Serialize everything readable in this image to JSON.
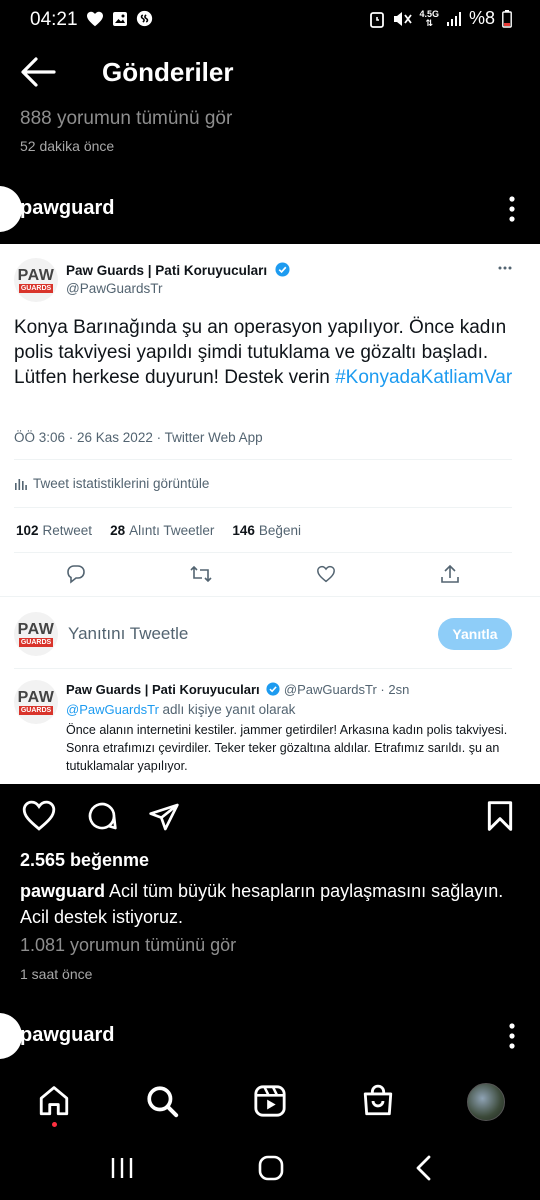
{
  "status_bar": {
    "time": "04:21",
    "network": "4.5G",
    "battery": "%8"
  },
  "header": {
    "title": "Gönderiler"
  },
  "previous_post": {
    "view_comments": "888 yorumun tümünü gör",
    "timestamp": "52 dakika önce"
  },
  "post": {
    "username": "pawguard",
    "tweet": {
      "logo_top": "PAW",
      "logo_bottom": "GUARDS",
      "author_name": "Paw Guards | Pati Koruyucuları",
      "author_handle": "@PawGuardsTr",
      "text": "Konya Barınağında şu an operasyon yapılıyor. Önce kadın polis takviyesi yapıldı şimdi tutuklama ve gözaltı başladı. Lütfen herkese duyurun! Destek verin",
      "hashtag": "#KonyadaKatliamVar",
      "meta": "ÖÖ 3:06 · 26 Kas 2022 · Twitter Web App",
      "stats_link": "Tweet istatistiklerini görüntüle",
      "retweets": "102",
      "retweets_label": "Retweet",
      "quotes": "28",
      "quotes_label": "Alıntı Tweetler",
      "likes": "146",
      "likes_label": "Beğeni",
      "reply_placeholder": "Yanıtını Tweetle",
      "reply_button": "Yanıtla",
      "reply": {
        "author_name": "Paw Guards | Pati Koruyucuları",
        "author_handle": "@PawGuardsTr",
        "time": "· 2sn",
        "replying_handle": "@PawGuardsTr",
        "replying_suffix": "adlı kişiye yanıt olarak",
        "text": "Önce alanın internetini kestiler. jammer getirdiler! Arkasına kadın polis takviyesi. Sonra etrafımızı çevirdiler. Teker teker gözaltına aldılar. Etrafımız sarıldı. şu an tutuklamalar yapılıyor."
      }
    },
    "likes": "2.565 beğenme",
    "caption_user": "pawguard",
    "caption_text": "Acil tüm büyük hesapların paylaşmasını sağlayın. Acil destek istiyoruz.",
    "view_comments": "1.081 yorumun tümünü gör",
    "timestamp": "1 saat önce"
  },
  "next_post": {
    "username": "pawguard"
  },
  "colors": {
    "background": "#000000",
    "twitter_blue": "#1d9bf0",
    "reply_button_disabled": "#8ecdf8",
    "notification_dot": "#ff3040"
  }
}
